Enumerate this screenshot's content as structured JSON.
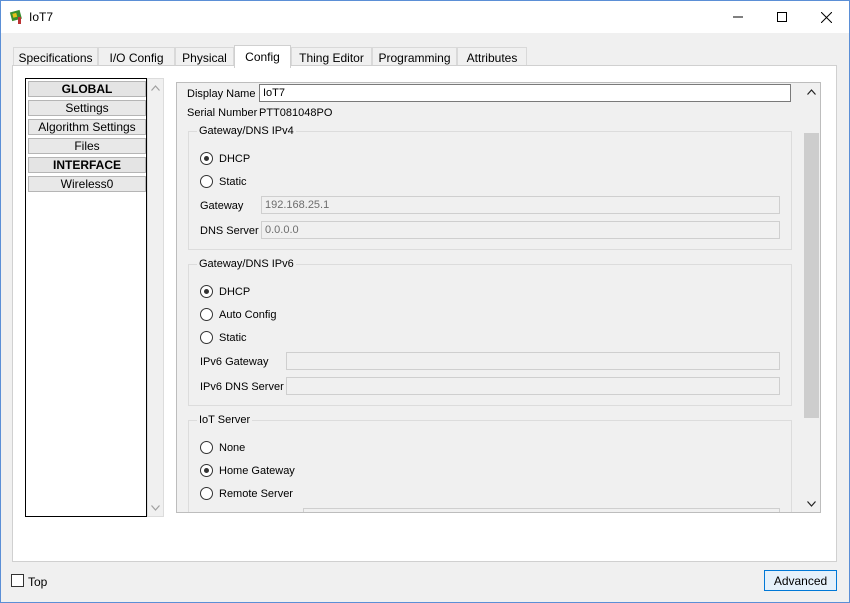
{
  "window": {
    "title": "IoT7",
    "controls": {
      "minimize": "minimize",
      "maximize": "maximize",
      "close": "close"
    }
  },
  "tabs": [
    {
      "label": "Specifications"
    },
    {
      "label": "I/O Config"
    },
    {
      "label": "Physical"
    },
    {
      "label": "Config",
      "active": true
    },
    {
      "label": "Thing Editor"
    },
    {
      "label": "Programming"
    },
    {
      "label": "Attributes"
    }
  ],
  "nav": {
    "items": [
      {
        "label": "GLOBAL",
        "header": true
      },
      {
        "label": "Settings"
      },
      {
        "label": "Algorithm Settings"
      },
      {
        "label": "Files"
      },
      {
        "label": "INTERFACE",
        "header": true
      },
      {
        "label": "Wireless0"
      }
    ]
  },
  "settings": {
    "display_name_label": "Display Name",
    "display_name_value": "IoT7",
    "serial_label": "Serial Number",
    "serial_value": "PTT081048PO",
    "ipv4": {
      "title": "Gateway/DNS IPv4",
      "dhcp_label": "DHCP",
      "static_label": "Static",
      "selected": "DHCP",
      "gateway_label": "Gateway",
      "gateway_value": "192.168.25.1",
      "dns_label": "DNS Server",
      "dns_value": "0.0.0.0"
    },
    "ipv6": {
      "title": "Gateway/DNS IPv6",
      "dhcp_label": "DHCP",
      "auto_label": "Auto Config",
      "static_label": "Static",
      "selected": "DHCP",
      "gateway_label": "IPv6 Gateway",
      "gateway_value": "",
      "dns_label": "IPv6 DNS Server",
      "dns_value": ""
    },
    "iot_server": {
      "title": "IoT Server",
      "none_label": "None",
      "home_label": "Home Gateway",
      "remote_label": "Remote Server",
      "selected": "Home Gateway"
    }
  },
  "footer": {
    "top_label": "Top",
    "top_checked": false,
    "advanced_label": "Advanced"
  },
  "colors": {
    "accent": "#0078d7",
    "window_border": "#5b8fd6",
    "background": "#f0f0f0"
  }
}
